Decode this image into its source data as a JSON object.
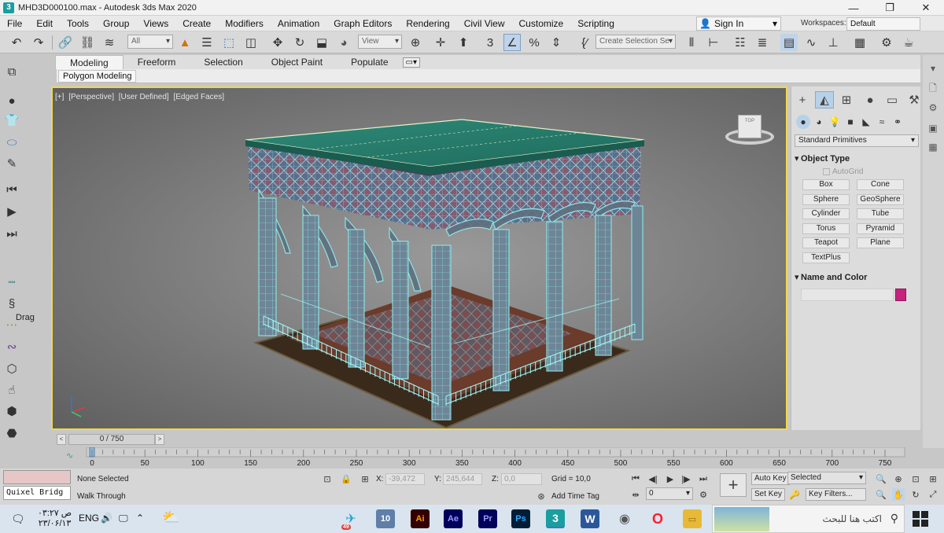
{
  "window": {
    "title": "MHD3D000100.max - Autodesk 3ds Max 2020",
    "app_icon": "3",
    "controls": [
      "—",
      "❐",
      "✕"
    ]
  },
  "menu": {
    "items": [
      "File",
      "Edit",
      "Tools",
      "Group",
      "Views",
      "Create",
      "Modifiers",
      "Animation",
      "Graph Editors",
      "Rendering",
      "Civil View",
      "Customize",
      "Scripting"
    ],
    "sign_in": "Sign In",
    "workspaces_label": "Workspaces:",
    "workspaces_value": "Default"
  },
  "toolbar": {
    "selection_filter": "All",
    "reference_coord": "View",
    "named_selection": "Create Selection Se"
  },
  "ribbon": {
    "tabs": [
      "Modeling",
      "Freeform",
      "Selection",
      "Object Paint",
      "Populate"
    ],
    "active_tab": "Modeling",
    "sub_label": "Polygon Modeling"
  },
  "left_toolbar": {
    "drag_label": "Drag"
  },
  "viewport": {
    "labels": [
      "[+]",
      "[Perspective]",
      "[User Defined]",
      "[Edged Faces]"
    ],
    "viewcube_face": "TOP"
  },
  "command_panel": {
    "category": "Standard Primitives",
    "object_type_header": "Object Type",
    "autogrid": "AutoGrid",
    "primitives": [
      "Box",
      "Cone",
      "Sphere",
      "GeoSphere",
      "Cylinder",
      "Tube",
      "Torus",
      "Pyramid",
      "Teapot",
      "Plane",
      "TextPlus"
    ],
    "name_color_header": "Name and Color",
    "object_color": "#c5237e"
  },
  "timeline": {
    "frame_display": "0 / 750",
    "ticks": [
      "0",
      "50",
      "100",
      "150",
      "200",
      "250",
      "300",
      "350",
      "400",
      "450",
      "500",
      "550",
      "600",
      "650",
      "700",
      "750"
    ]
  },
  "status": {
    "quixel": "Quixel Bridg",
    "selection": "None Selected",
    "prompt": "Walk Through",
    "x_label": "X:",
    "x_value": "-39,472",
    "y_label": "Y:",
    "y_value": "245,644",
    "z_label": "Z:",
    "z_value": "0,0",
    "grid": "Grid = 10,0",
    "add_time_tag": "Add Time Tag",
    "auto_key": "Auto Key",
    "set_key": "Set Key",
    "key_mode": "Selected",
    "key_filters": "Key Filters...",
    "current_frame": "0"
  },
  "taskbar": {
    "time": "۰۳:۲۷ ص",
    "date": "۲۳/۰۶/۱۳",
    "language": "ENG",
    "search_placeholder": "اكتب هنا للبحث",
    "telegram_badge": "49",
    "apps": [
      {
        "name": "telegram-app",
        "label": "✈",
        "color": "#2aa3d8"
      },
      {
        "name": "winrar-app",
        "label": "10",
        "color": "#5d7fa8"
      },
      {
        "name": "illustrator-app",
        "label": "Ai",
        "color": "#ff7c00"
      },
      {
        "name": "after-effects-app",
        "label": "Ae",
        "color": "#9999ff"
      },
      {
        "name": "premiere-app",
        "label": "Pr",
        "color": "#9999ff"
      },
      {
        "name": "photoshop-app",
        "label": "Ps",
        "color": "#31a8ff"
      },
      {
        "name": "3dsmax-app",
        "label": "3",
        "color": "#1a9e9e"
      },
      {
        "name": "word-app",
        "label": "W",
        "color": "#2b579a"
      },
      {
        "name": "media-app",
        "label": "◉",
        "color": "#666666"
      },
      {
        "name": "opera-app",
        "label": "O",
        "color": "#ff1b2d"
      },
      {
        "name": "explorer-app",
        "label": "▭",
        "color": "#e8b937"
      }
    ]
  }
}
